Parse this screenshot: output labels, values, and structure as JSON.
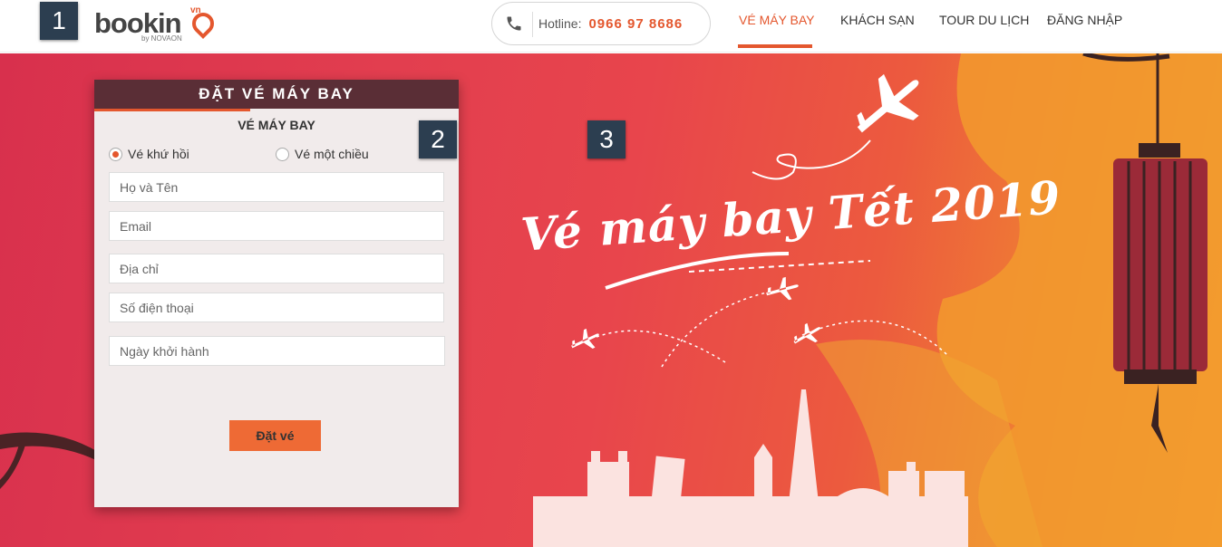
{
  "badges": [
    "1",
    "2",
    "3"
  ],
  "logo": {
    "text": "bookin",
    "superscript": "vn",
    "tagline": "by NOVAON"
  },
  "hotline": {
    "label": "Hotline:",
    "number": "0966 97 8686"
  },
  "nav": [
    {
      "label": "VÉ MÁY BAY",
      "active": true
    },
    {
      "label": "KHÁCH SẠN"
    },
    {
      "label": "TOUR DU LỊCH"
    },
    {
      "label": "ĐĂNG NHẬP"
    }
  ],
  "hero": {
    "title": "Vé máy bay Tết 2019"
  },
  "form": {
    "header": "ĐẶT VÉ MÁY BAY",
    "subtitle": "VÉ MÁY BAY",
    "trip_types": [
      {
        "label": "Vé khứ hồi",
        "selected": true
      },
      {
        "label": "Vé một chiều",
        "selected": false
      }
    ],
    "fields": [
      {
        "placeholder": "Họ và Tên"
      },
      {
        "placeholder": "Email"
      },
      {
        "placeholder": "Địa chỉ"
      },
      {
        "placeholder": "Số điện thoại"
      },
      {
        "placeholder": "Ngày khởi hành"
      }
    ],
    "submit": "Đặt vé"
  },
  "colors": {
    "accent": "#e4572e",
    "form_header": "#5a2e36",
    "badge": "#2c3e50"
  }
}
